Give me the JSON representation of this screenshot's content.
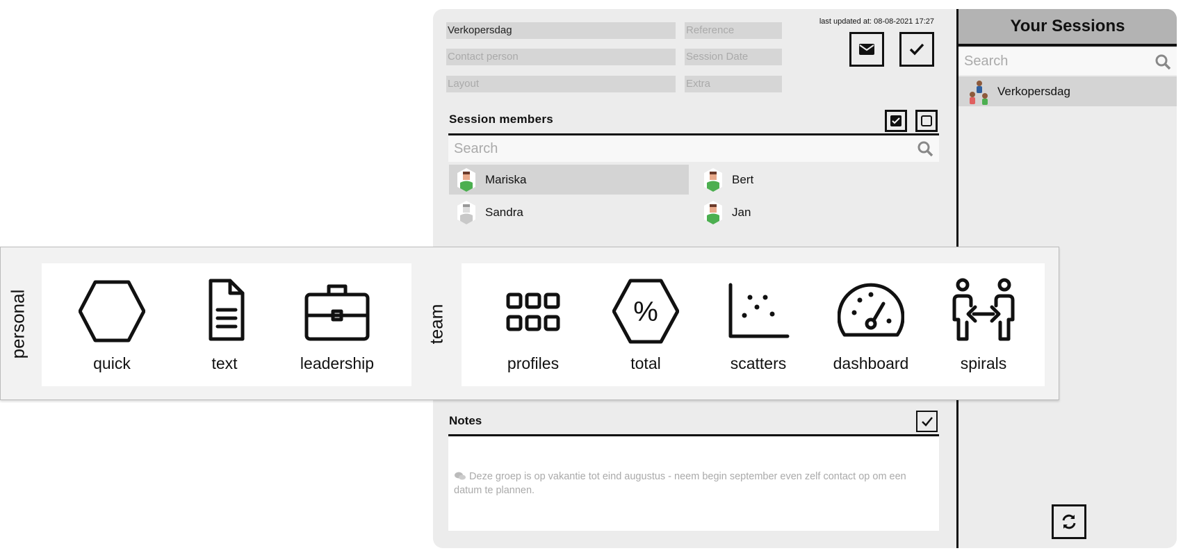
{
  "session_form": {
    "name_value": "Verkopersdag",
    "reference_placeholder": "Reference",
    "contact_placeholder": "Contact person",
    "date_placeholder": "Session Date",
    "layout_placeholder": "Layout",
    "extra_placeholder": "Extra",
    "last_updated": "last updated at: 08-08-2021 17:27"
  },
  "members": {
    "title": "Session members",
    "search_placeholder": "Search",
    "items": [
      {
        "name": "Mariska",
        "selected": true,
        "active": true
      },
      {
        "name": "Bert",
        "selected": false,
        "active": true
      },
      {
        "name": "Sandra",
        "selected": false,
        "active": false
      },
      {
        "name": "Jan",
        "selected": false,
        "active": true
      }
    ]
  },
  "reports": {
    "personal_label": "personal",
    "team_label": "team",
    "personal": [
      {
        "label": "quick",
        "icon": "hexagon-icon"
      },
      {
        "label": "text",
        "icon": "document-icon"
      },
      {
        "label": "leadership",
        "icon": "briefcase-icon"
      }
    ],
    "team": [
      {
        "label": "profiles",
        "icon": "grid-icon"
      },
      {
        "label": "total",
        "icon": "percent-hexagon-icon"
      },
      {
        "label": "scatters",
        "icon": "scatter-plot-icon"
      },
      {
        "label": "dashboard",
        "icon": "gauge-icon"
      },
      {
        "label": "spirals",
        "icon": "people-exchange-icon"
      }
    ]
  },
  "notes": {
    "title": "Notes",
    "text": "Deze groep is op vakantie tot eind augustus - neem begin september even zelf contact op om een datum te plannen."
  },
  "sidebar": {
    "title": "Your Sessions",
    "search_placeholder": "Search",
    "sessions": [
      {
        "name": "Verkopersdag"
      }
    ]
  },
  "colors": {
    "panel": "#ececec",
    "avatar_green": "#4caf50",
    "selected": "#d4d4d4",
    "header": "#b3b3b3"
  }
}
